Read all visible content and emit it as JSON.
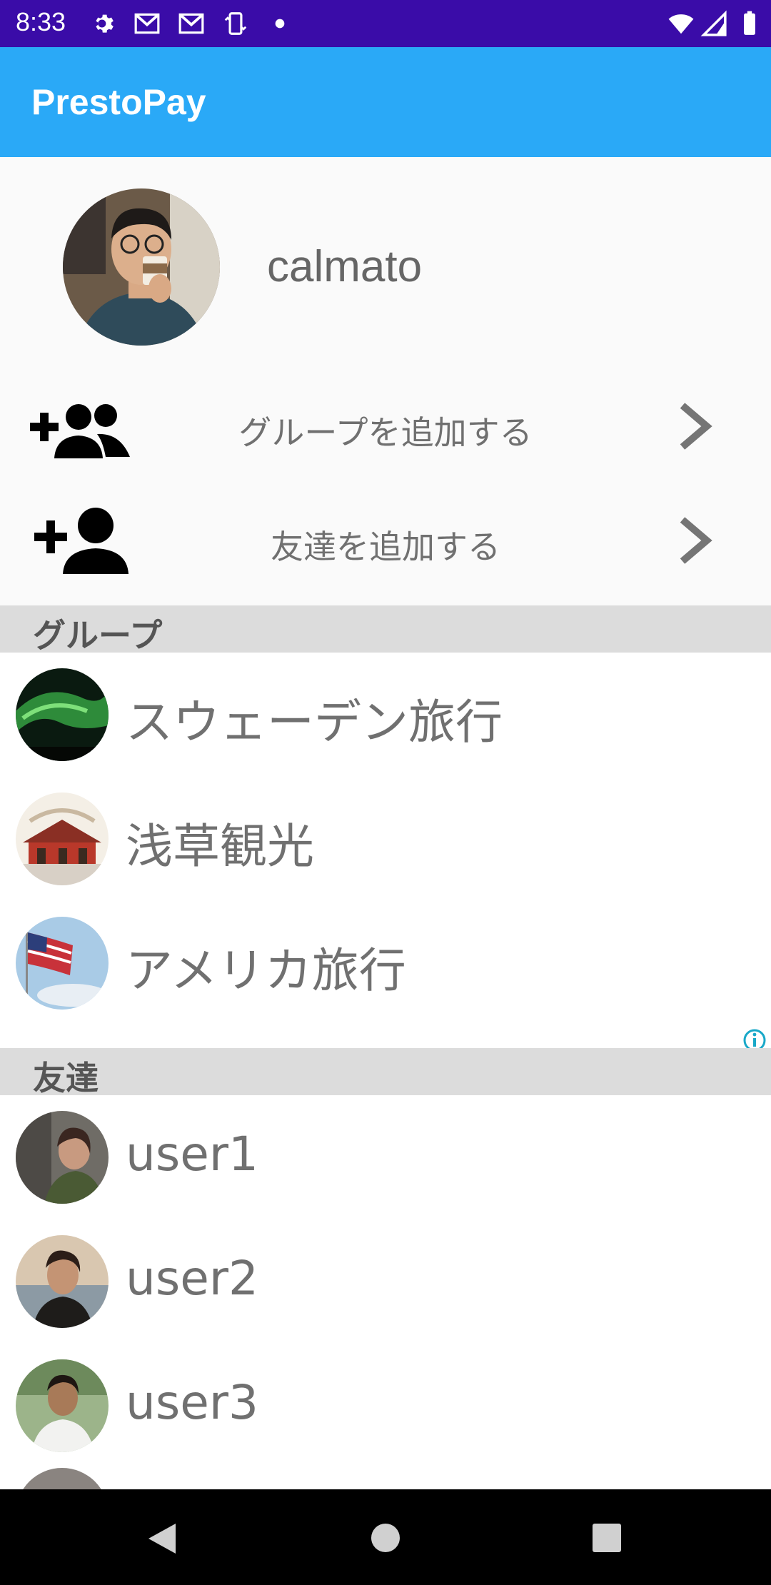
{
  "status_bar": {
    "time": "8:33",
    "icons": [
      "settings-icon",
      "gmail-icon",
      "gmail-icon",
      "phone-rotate-icon",
      "dot-icon",
      "wifi-icon",
      "signal-icon",
      "battery-icon"
    ]
  },
  "app_bar": {
    "title": "PrestoPay"
  },
  "profile": {
    "username": "calmato"
  },
  "actions": [
    {
      "label": "グループを追加する",
      "icon": "group-add-icon"
    },
    {
      "label": "友達を追加する",
      "icon": "person-add-icon"
    }
  ],
  "groups": {
    "header": "グループ",
    "items": [
      {
        "label": "スウェーデン旅行"
      },
      {
        "label": "浅草観光"
      },
      {
        "label": "アメリカ旅行"
      }
    ]
  },
  "friends": {
    "header": "友達",
    "items": [
      {
        "label": "user1"
      },
      {
        "label": "user2"
      },
      {
        "label": "user3"
      }
    ]
  },
  "colors": {
    "status_bar": "#3a0ca8",
    "app_bar": "#2aa9f7",
    "section_header": "#dcdcdc"
  },
  "nav_bar": {
    "icons": [
      "back-icon",
      "home-icon",
      "recents-icon"
    ]
  }
}
